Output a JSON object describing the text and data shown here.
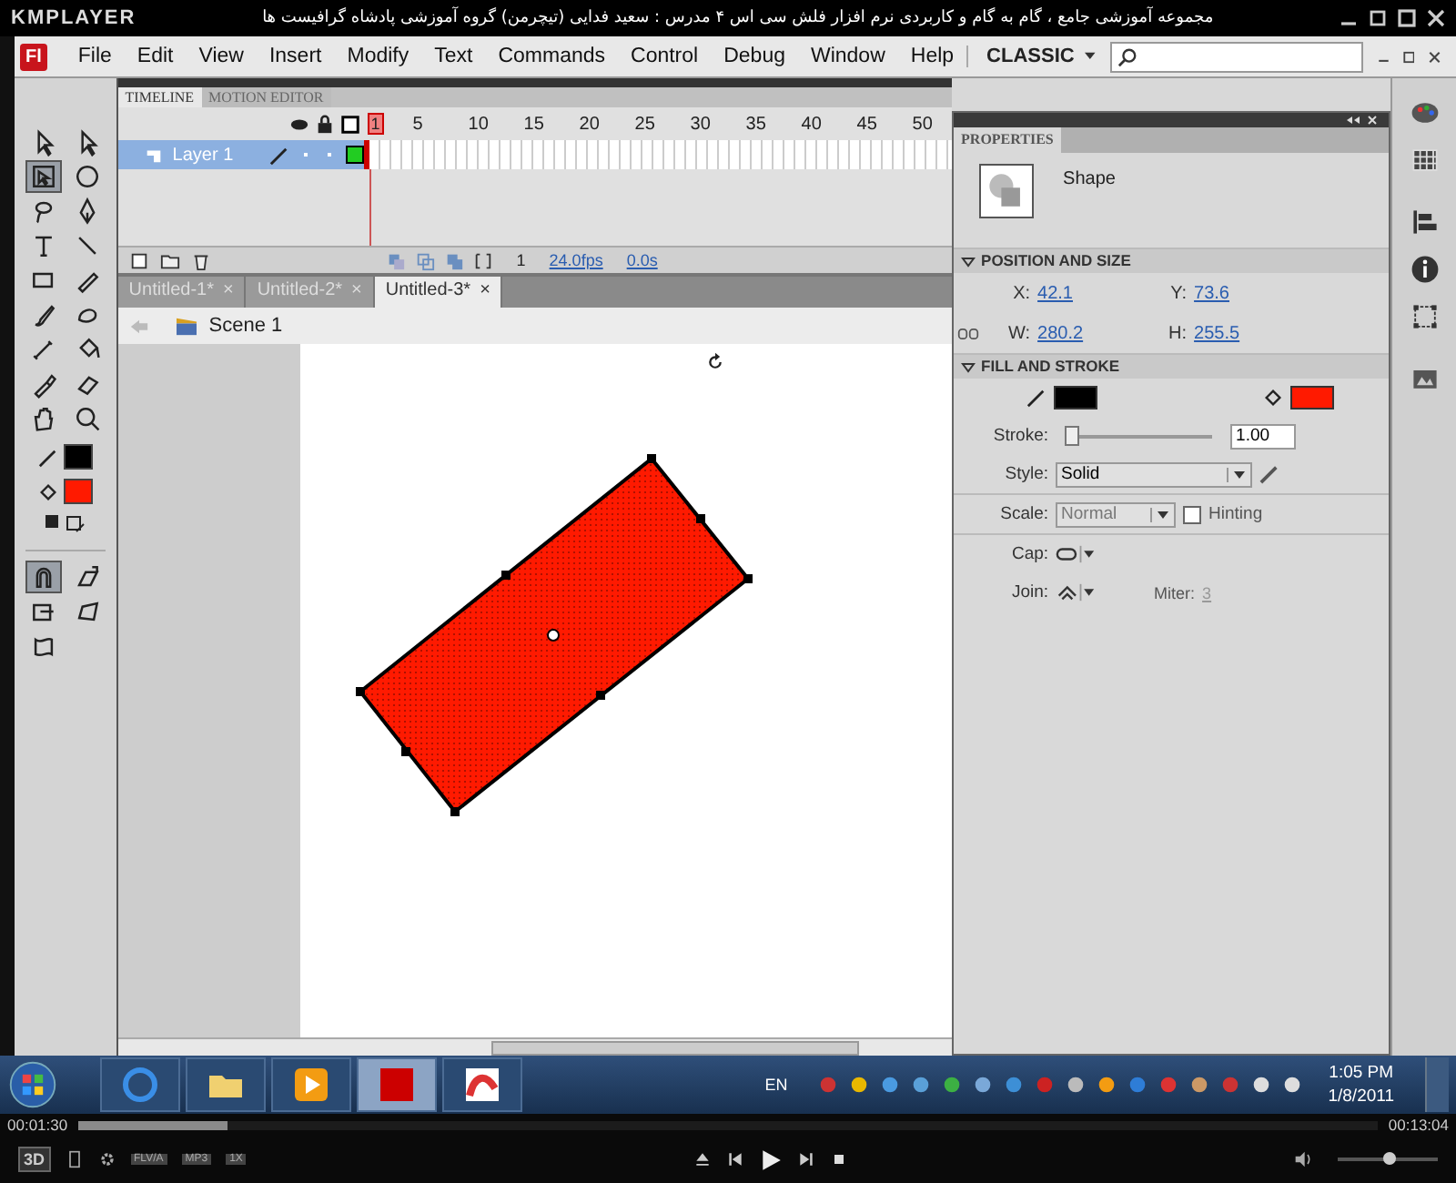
{
  "player": {
    "logo": "KMPLAYER",
    "title": "مجموعه آموزشی جامع ، گام به گام و کاربردی نرم افزار فلش سی اس ۴ مدرس : سعید فدایی (تیچرمن) گروه آموزشی پادشاه گرافیست ها",
    "elapsed": "00:01:30",
    "total": "00:13:04",
    "progress": {
      "level": 0.115
    },
    "volume": {
      "level": 0.5
    },
    "badges": [
      "FLV/A",
      "MP3",
      "1X"
    ],
    "three_d": "3D"
  },
  "app": {
    "logo": "Fl",
    "menus": [
      "File",
      "Edit",
      "View",
      "Insert",
      "Modify",
      "Text",
      "Commands",
      "Control",
      "Debug",
      "Window",
      "Help"
    ],
    "workspace": "CLASSIC"
  },
  "tools": {
    "items": [
      {
        "kind": "arrow",
        "selected": false
      },
      {
        "kind": "subselect",
        "selected": false
      },
      {
        "kind": "transform",
        "selected": true
      },
      {
        "kind": "sphere",
        "selected": false
      },
      {
        "kind": "lasso",
        "selected": false
      },
      {
        "kind": "pen",
        "selected": false
      },
      {
        "kind": "text",
        "selected": false
      },
      {
        "kind": "line",
        "selected": false
      },
      {
        "kind": "rect",
        "selected": false
      },
      {
        "kind": "pencil",
        "selected": false
      },
      {
        "kind": "brush",
        "selected": false
      },
      {
        "kind": "deco",
        "selected": false
      },
      {
        "kind": "bone",
        "selected": false
      },
      {
        "kind": "bucket",
        "selected": false
      },
      {
        "kind": "eyedropper",
        "selected": false
      },
      {
        "kind": "eraser",
        "selected": false
      },
      {
        "kind": "hand",
        "selected": false
      },
      {
        "kind": "zoom",
        "selected": false
      }
    ],
    "stroke": {
      "color": "#000000"
    },
    "fill": {
      "color": "#ff1a00"
    },
    "options": [
      {
        "kind": "magnet",
        "selected": true
      },
      {
        "kind": "rotate",
        "selected": false
      },
      {
        "kind": "scale",
        "selected": false
      },
      {
        "kind": "distort",
        "selected": false
      },
      {
        "kind": "envelope",
        "selected": false
      }
    ]
  },
  "timeline": {
    "tabs": [
      {
        "label": "TIMELINE",
        "selected": true
      },
      {
        "label": "MOTION EDITOR",
        "selected": false
      }
    ],
    "frames": [
      "1",
      "5",
      "10",
      "15",
      "20",
      "25",
      "30",
      "35",
      "40",
      "45",
      "50"
    ],
    "layers": [
      {
        "name": "Layer 1",
        "selected": true
      }
    ],
    "current_frame": "1",
    "fps": "24.0fps",
    "time": "0.0s"
  },
  "documents": [
    {
      "title": "Untitled-1*",
      "selected": false
    },
    {
      "title": "Untitled-2*",
      "selected": false
    },
    {
      "title": "Untitled-3*",
      "selected": true
    }
  ],
  "close_glyph": "×",
  "scene": "Scene 1",
  "properties": {
    "tab": "PROPERTIES",
    "type": "Shape",
    "sections": [
      {
        "title": "POSITION AND SIZE",
        "expanded": true
      },
      {
        "title": "FILL AND STROKE",
        "expanded": true
      }
    ],
    "position": [
      {
        "label": "X:",
        "value": "42.1"
      },
      {
        "label": "Y:",
        "value": "73.6"
      },
      {
        "label": "W:",
        "value": "280.2"
      },
      {
        "label": "H:",
        "value": "255.5"
      }
    ],
    "stroke_swatch": {
      "color": "#000000"
    },
    "fill_swatch": {
      "color": "#ff1a00"
    },
    "stroke": {
      "label": "Stroke:",
      "level": 0.02,
      "value": "1.00"
    },
    "style": {
      "label": "Style:",
      "value": "Solid"
    },
    "scale": {
      "label": "Scale:",
      "value": "Normal"
    },
    "hinting": {
      "label": "Hinting",
      "checked": false
    },
    "cap": {
      "label": "Cap:"
    },
    "join": {
      "label": "Join:"
    },
    "miter": {
      "label": "Miter:",
      "value": "3"
    }
  },
  "taskbar": {
    "apps": [
      {
        "kind": "browser",
        "selected": false
      },
      {
        "kind": "folder",
        "selected": false
      },
      {
        "kind": "media",
        "selected": false
      },
      {
        "kind": "flash",
        "selected": true
      },
      {
        "kind": "player",
        "selected": false
      }
    ],
    "language": "EN",
    "time": "1:05 PM",
    "date": "1/8/2011"
  }
}
